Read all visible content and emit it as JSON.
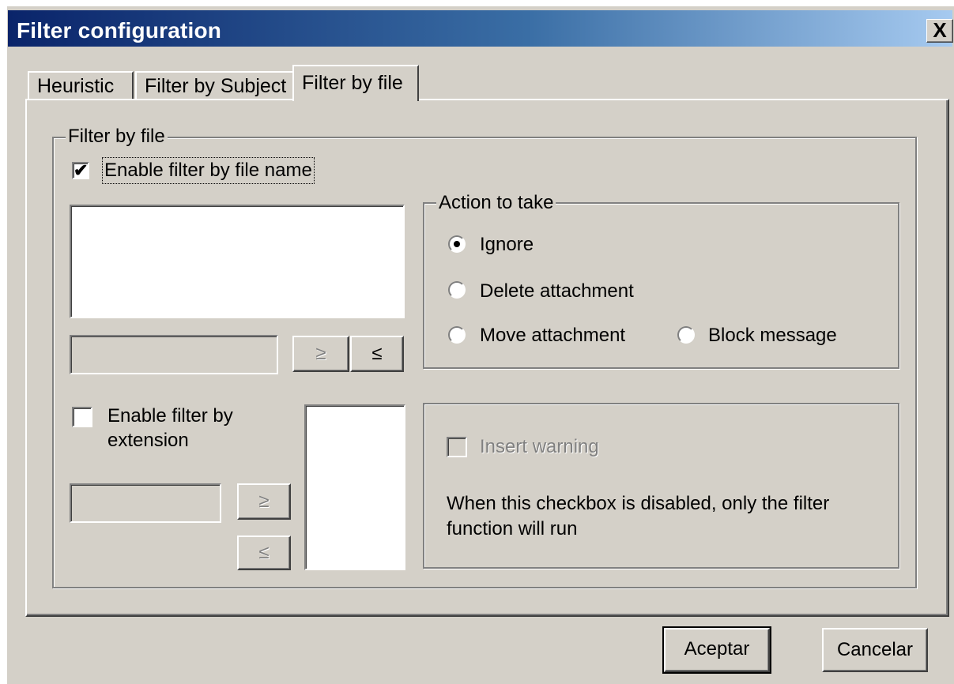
{
  "window": {
    "title": "Filter configuration",
    "close_label": "X"
  },
  "tabs": [
    {
      "label": "Heuristic"
    },
    {
      "label": "Filter by Subject"
    },
    {
      "label": "Filter by file"
    }
  ],
  "filter_group": {
    "legend": "Filter by file",
    "enable_filename_label": "Enable filter by file name",
    "enable_filename_checked": true,
    "add_label": "≥",
    "remove_label": "≤",
    "enable_extension_label_line1": "Enable filter by",
    "enable_extension_label_line2": "extension",
    "enable_extension_checked": false
  },
  "action_group": {
    "legend": "Action to take",
    "options": [
      {
        "label": "Ignore",
        "selected": true
      },
      {
        "label": "Delete attachment",
        "selected": false
      },
      {
        "label": "Move attachment",
        "selected": false
      },
      {
        "label": "Block message",
        "selected": false
      }
    ]
  },
  "warning_group": {
    "insert_warning_label": "Insert warning",
    "note_line1": "When this checkbox is disabled, only the filter",
    "note_line2": "function will run"
  },
  "footer": {
    "ok_label": "Aceptar",
    "cancel_label": "Cancelar"
  }
}
